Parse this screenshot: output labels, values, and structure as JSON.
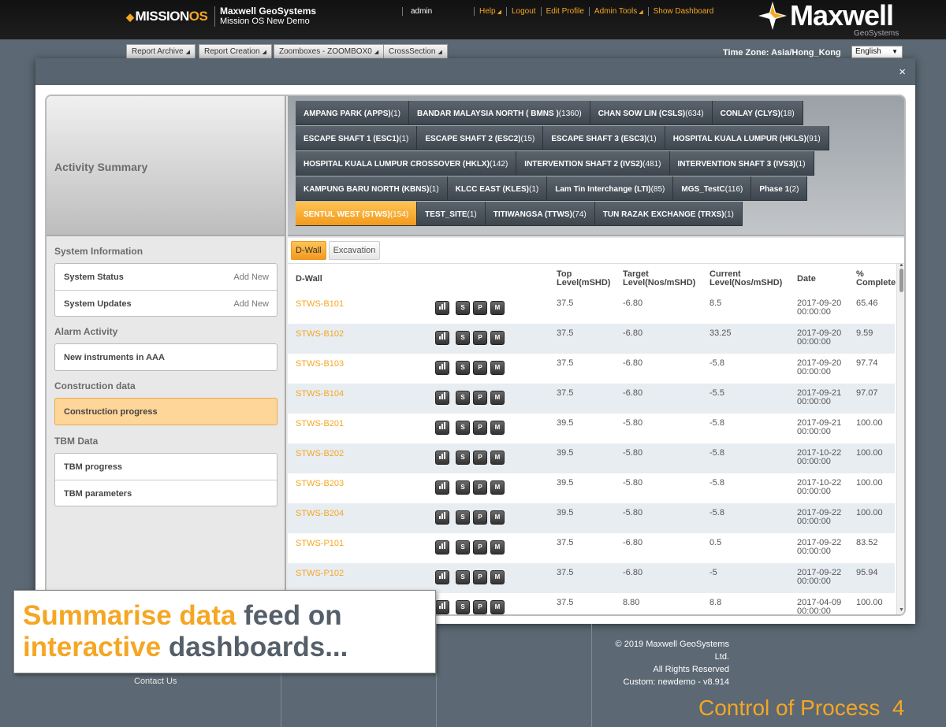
{
  "header": {
    "logo_prefix": "MISSION",
    "logo_suffix": "OS",
    "org_name": "Maxwell GeoSystems",
    "org_sub": "Mission OS New Demo",
    "user": "admin",
    "nav": [
      "Help",
      "Logout",
      "Edit Profile",
      "Admin Tools",
      "Show Dashboard"
    ],
    "brand_word": "Maxwell",
    "brand_sub": "GeoSystems"
  },
  "toolbar": {
    "tabs": [
      "Report Archive",
      "Report Creation",
      "Zoomboxes - ZOOMBOX0",
      "CrossSection"
    ],
    "timezone_label": "Time Zone: Asia/Hong_Kong",
    "language": "English"
  },
  "modal": {
    "close": "×",
    "summary_title": "Activity Summary"
  },
  "sites": [
    [
      [
        "AMPANG PARK (APPS)",
        "(1)"
      ],
      [
        "BANDAR MALAYSIA NORTH ( BMNS )",
        "(1360)"
      ],
      [
        "CHAN SOW LIN (CSLS)",
        "(634)"
      ],
      [
        "CONLAY (CLYS)",
        "(18)"
      ]
    ],
    [
      [
        "ESCAPE SHAFT 1 (ESC1)",
        "(1)"
      ],
      [
        "ESCAPE SHAFT 2 (ESC2)",
        "(15)"
      ],
      [
        "ESCAPE SHAFT 3 (ESC3)",
        "(1)"
      ],
      [
        "HOSPITAL KUALA LUMPUR (HKLS)",
        "(91)"
      ]
    ],
    [
      [
        "HOSPITAL KUALA LUMPUR CROSSOVER (HKLX)",
        "(142)"
      ],
      [
        "INTERVENTION SHAFT 2 (IVS2)",
        "(481)"
      ],
      [
        "INTERVENTION SHAFT 3 (IVS3)",
        "(1)"
      ]
    ],
    [
      [
        "KAMPUNG BARU NORTH (KBNS)",
        "(1)"
      ],
      [
        "KLCC EAST (KLES)",
        "(1)"
      ],
      [
        "Lam Tin Interchange (LTI)",
        "(85)"
      ],
      [
        "MGS_TestC",
        "(116)"
      ],
      [
        "Phase 1",
        "(2)"
      ]
    ],
    [
      [
        "SENTUL WEST (STWS)",
        "(154)"
      ],
      [
        "TEST_SITE",
        "(1)"
      ],
      [
        "TITIWANGSA (TTWS)",
        "(74)"
      ],
      [
        "TUN RAZAK EXCHANGE (TRXS)",
        "(1)"
      ]
    ]
  ],
  "active_site": "SENTUL WEST (STWS)",
  "sidebar": {
    "system_info_title": "System Information",
    "system_status": "System Status",
    "system_updates": "System Updates",
    "add_new": "Add New",
    "alarm_title": "Alarm Activity",
    "alarm_item": "New instruments in AAA",
    "construction_title": "Construction data",
    "construction_item": "Construction progress",
    "tbm_title": "TBM Data",
    "tbm_progress": "TBM progress",
    "tbm_parameters": "TBM parameters"
  },
  "type_tabs": [
    "D-Wall",
    "Excavation"
  ],
  "table": {
    "headers": {
      "name": "D-Wall",
      "top_1": "Top",
      "top_2": "Level(mSHD)",
      "target_1": "Target",
      "target_2": "Level(Nos/mSHD)",
      "current_1": "Current",
      "current_2": "Level(Nos/mSHD)",
      "date": "Date",
      "pct_1": "%",
      "pct_2": "Complete"
    },
    "buttons": [
      "S",
      "P",
      "M"
    ],
    "rows": [
      {
        "name": "STWS-B101",
        "top": "37.5",
        "target": "-6.80",
        "current": "8.5",
        "date": "2017-09-20",
        "time": "00:00:00",
        "pct": "65.46"
      },
      {
        "name": "STWS-B102",
        "top": "37.5",
        "target": "-6.80",
        "current": "33.25",
        "date": "2017-09-20",
        "time": "00:00:00",
        "pct": "9.59"
      },
      {
        "name": "STWS-B103",
        "top": "37.5",
        "target": "-6.80",
        "current": "-5.8",
        "date": "2017-09-20",
        "time": "00:00:00",
        "pct": "97.74"
      },
      {
        "name": "STWS-B104",
        "top": "37.5",
        "target": "-6.80",
        "current": "-5.5",
        "date": "2017-09-21",
        "time": "00:00:00",
        "pct": "97.07"
      },
      {
        "name": "STWS-B201",
        "top": "39.5",
        "target": "-5.80",
        "current": "-5.8",
        "date": "2017-09-21",
        "time": "00:00:00",
        "pct": "100.00"
      },
      {
        "name": "STWS-B202",
        "top": "39.5",
        "target": "-5.80",
        "current": "-5.8",
        "date": "2017-10-22",
        "time": "00:00:00",
        "pct": "100.00"
      },
      {
        "name": "STWS-B203",
        "top": "39.5",
        "target": "-5.80",
        "current": "-5.8",
        "date": "2017-10-22",
        "time": "00:00:00",
        "pct": "100.00"
      },
      {
        "name": "STWS-B204",
        "top": "39.5",
        "target": "-5.80",
        "current": "-5.8",
        "date": "2017-09-22",
        "time": "00:00:00",
        "pct": "100.00"
      },
      {
        "name": "STWS-P101",
        "top": "37.5",
        "target": "-6.80",
        "current": "0.5",
        "date": "2017-09-22",
        "time": "00:00:00",
        "pct": "83.52"
      },
      {
        "name": "STWS-P102",
        "top": "37.5",
        "target": "-6.80",
        "current": "-5",
        "date": "2017-09-22",
        "time": "00:00:00",
        "pct": "95.94"
      },
      {
        "name": "",
        "top": "37.5",
        "target": "8.80",
        "current": "8.8",
        "date": "2017-04-09",
        "time": "00:00:00",
        "pct": "100.00"
      }
    ]
  },
  "footer": {
    "copyright": "© 2019 Maxwell GeoSystems Ltd.",
    "rights": "All Rights Reserved",
    "custom": "Custom: newdemo - v8.914",
    "contact": "Contact Us",
    "control_text": "Control of Process",
    "control_num": "4"
  },
  "callout": {
    "l1_orange": "Summarise data",
    "l1_gray": "feed on",
    "l2_orange": "interactive",
    "l2_gray": "dashboards..."
  },
  "colors": {
    "accent": "#f5a623",
    "header_bg": "#111111",
    "page_bg": "#5c6873",
    "tab_dark": "#4a535a"
  }
}
